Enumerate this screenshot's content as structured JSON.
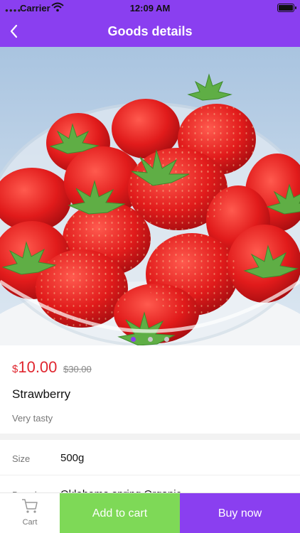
{
  "status": {
    "carrier": "Carrier",
    "time": "12:09 AM"
  },
  "nav": {
    "title": "Goods details",
    "back_icon": "chevron-left-icon"
  },
  "gallery": {
    "image": "strawberries-in-glass-bowl",
    "page_count": 3,
    "active_page": 1
  },
  "product": {
    "currency": "$",
    "price": "10.00",
    "old_price": "$30.00",
    "name": "Strawberry",
    "description": "Very tasty"
  },
  "specs": [
    {
      "key": "Size",
      "value": "500g"
    },
    {
      "key": "Brand",
      "value": "Oklahoma spring Organic"
    }
  ],
  "actions": {
    "cart_label": "Cart",
    "add_to_cart": "Add to cart",
    "buy_now": "Buy now"
  },
  "colors": {
    "accent": "#8a3ff0",
    "add_to_cart": "#7ed957",
    "price": "#e0262f"
  }
}
